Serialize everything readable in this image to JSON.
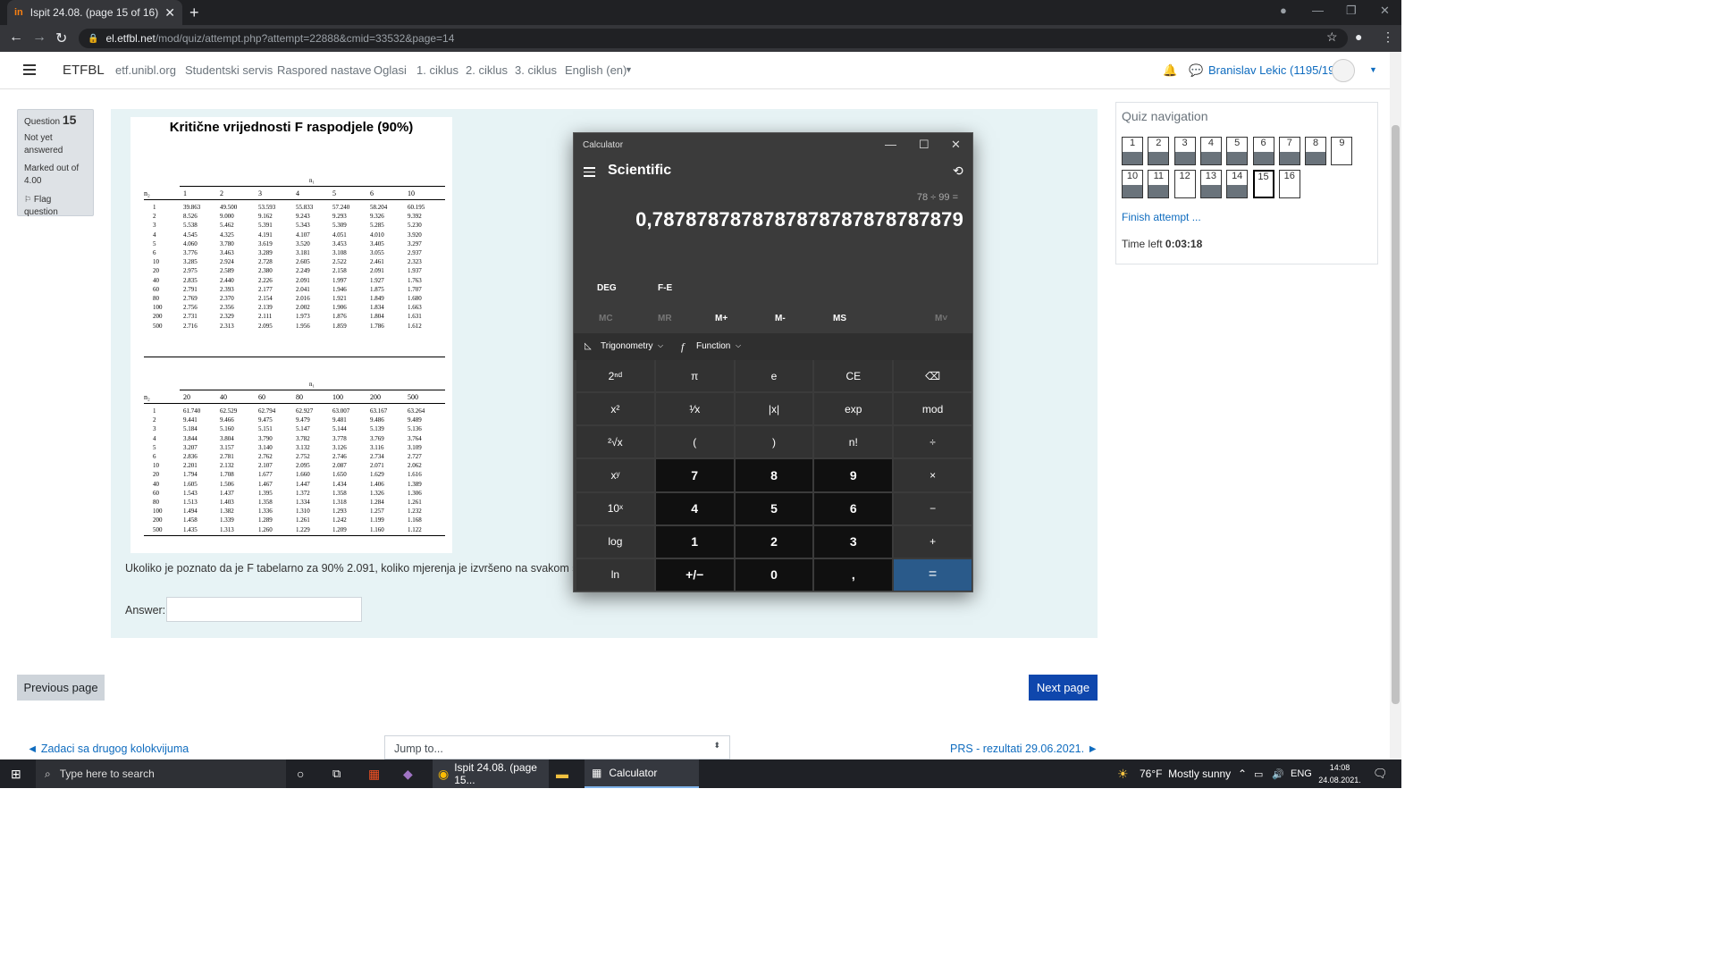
{
  "browser": {
    "tab_title": "Ispit 24.08. (page 15 of 16)",
    "tab_favicon": "in",
    "new_tab": "+",
    "url_host": "el.etfbl.net",
    "url_path": "/mod/quiz/attempt.php?attempt=22888&cmid=33532&page=14"
  },
  "moodle_nav": {
    "brand": "ETFBL",
    "links": [
      "etf.unibl.org",
      "Studentski servis",
      "Raspored nastave",
      "Oglasi",
      "1. ciklus",
      "2. ciklus",
      "3. ciklus",
      "English (en)"
    ],
    "user": "Branislav Lekic (1195/19)"
  },
  "question_info": {
    "label": "Question",
    "number": "15",
    "status": "Not yet answered",
    "marks": "Marked out of 4.00",
    "flag": "Flag question"
  },
  "table_image": {
    "title": "Kritične vrijednosti F raspodjele (90%)",
    "n1_label": "n₁",
    "n2_label": "n₂",
    "top_cols": [
      "1",
      "2",
      "3",
      "4",
      "5",
      "6",
      "10"
    ],
    "bottom_cols": [
      "20",
      "40",
      "60",
      "80",
      "100",
      "200",
      "500"
    ],
    "row_labels": [
      "1",
      "2",
      "3",
      "4",
      "5",
      "6",
      "10",
      "20",
      "40",
      "60",
      "80",
      "100",
      "200",
      "500"
    ],
    "top_rows": [
      [
        "39.863",
        "49.500",
        "53.593",
        "55.833",
        "57.240",
        "58.204",
        "60.195"
      ],
      [
        "8.526",
        "9.000",
        "9.162",
        "9.243",
        "9.293",
        "9.326",
        "9.392"
      ],
      [
        "5.538",
        "5.462",
        "5.391",
        "5.343",
        "5.309",
        "5.285",
        "5.230"
      ],
      [
        "4.545",
        "4.325",
        "4.191",
        "4.107",
        "4.051",
        "4.010",
        "3.920"
      ],
      [
        "4.060",
        "3.780",
        "3.619",
        "3.520",
        "3.453",
        "3.405",
        "3.297"
      ],
      [
        "3.776",
        "3.463",
        "3.289",
        "3.181",
        "3.108",
        "3.055",
        "2.937"
      ],
      [
        "3.285",
        "2.924",
        "2.728",
        "2.605",
        "2.522",
        "2.461",
        "2.323"
      ],
      [
        "2.975",
        "2.589",
        "2.380",
        "2.249",
        "2.158",
        "2.091",
        "1.937"
      ],
      [
        "2.835",
        "2.440",
        "2.226",
        "2.091",
        "1.997",
        "1.927",
        "1.763"
      ],
      [
        "2.791",
        "2.393",
        "2.177",
        "2.041",
        "1.946",
        "1.875",
        "1.707"
      ],
      [
        "2.769",
        "2.370",
        "2.154",
        "2.016",
        "1.921",
        "1.849",
        "1.680"
      ],
      [
        "2.756",
        "2.356",
        "2.139",
        "2.002",
        "1.906",
        "1.834",
        "1.663"
      ],
      [
        "2.731",
        "2.329",
        "2.111",
        "1.973",
        "1.876",
        "1.804",
        "1.631"
      ],
      [
        "2.716",
        "2.313",
        "2.095",
        "1.956",
        "1.859",
        "1.786",
        "1.612"
      ]
    ],
    "bottom_rows": [
      [
        "61.740",
        "62.529",
        "62.794",
        "62.927",
        "63.007",
        "63.167",
        "63.264"
      ],
      [
        "9.441",
        "9.466",
        "9.475",
        "9.479",
        "9.481",
        "9.486",
        "9.489"
      ],
      [
        "5.184",
        "5.160",
        "5.151",
        "5.147",
        "5.144",
        "5.139",
        "5.136"
      ],
      [
        "3.844",
        "3.804",
        "3.790",
        "3.782",
        "3.778",
        "3.769",
        "3.764"
      ],
      [
        "3.207",
        "3.157",
        "3.140",
        "3.132",
        "3.126",
        "3.116",
        "3.109"
      ],
      [
        "2.836",
        "2.781",
        "2.762",
        "2.752",
        "2.746",
        "2.734",
        "2.727"
      ],
      [
        "2.201",
        "2.132",
        "2.107",
        "2.095",
        "2.087",
        "2.071",
        "2.062"
      ],
      [
        "1.794",
        "1.708",
        "1.677",
        "1.660",
        "1.650",
        "1.629",
        "1.616"
      ],
      [
        "1.605",
        "1.506",
        "1.467",
        "1.447",
        "1.434",
        "1.406",
        "1.389"
      ],
      [
        "1.543",
        "1.437",
        "1.395",
        "1.372",
        "1.358",
        "1.326",
        "1.306"
      ],
      [
        "1.513",
        "1.403",
        "1.358",
        "1.334",
        "1.318",
        "1.284",
        "1.261"
      ],
      [
        "1.494",
        "1.382",
        "1.336",
        "1.310",
        "1.293",
        "1.257",
        "1.232"
      ],
      [
        "1.458",
        "1.339",
        "1.289",
        "1.261",
        "1.242",
        "1.199",
        "1.168"
      ],
      [
        "1.435",
        "1.313",
        "1.260",
        "1.229",
        "1.209",
        "1.160",
        "1.122"
      ]
    ]
  },
  "question": {
    "text": "Ukoliko je poznato da je F tabelarno za 90% 2.091, koliko mjerenja je izvršeno na svakom sist",
    "answer_label": "Answer:",
    "answer_value": ""
  },
  "quiz_nav": {
    "title": "Quiz navigation",
    "buttons": [
      "1",
      "2",
      "3",
      "4",
      "5",
      "6",
      "7",
      "8",
      "9",
      "10",
      "11",
      "12",
      "13",
      "14",
      "15",
      "16"
    ],
    "finish": "Finish attempt ...",
    "time_label": "Time left",
    "time_value": "0:03:18"
  },
  "page_buttons": {
    "previous": "Previous page",
    "next": "Next page"
  },
  "footer": {
    "prev_link": "◄ Zadaci sa drugog kolokvijuma",
    "jump": "Jump to...",
    "next_link": "PRS - rezultati 29.06.2021. ►"
  },
  "calculator": {
    "window_title": "Calculator",
    "mode": "Scientific",
    "expression": "78 ÷ 99 =",
    "display": "0,7878787878787878787878787879",
    "deg": "DEG",
    "fe": "F-E",
    "memory": [
      "MC",
      "MR",
      "M+",
      "M-",
      "MS",
      "M˅"
    ],
    "trig": "Trigonometry",
    "func": "Function",
    "keys": [
      "2ⁿᵈ",
      "π",
      "e",
      "CE",
      "⌫",
      "x²",
      "¹⁄x",
      "|x|",
      "exp",
      "mod",
      "²√x",
      "(",
      ")",
      "n!",
      "÷",
      "xʸ",
      "7",
      "8",
      "9",
      "×",
      "10ˣ",
      "4",
      "5",
      "6",
      "−",
      "log",
      "1",
      "2",
      "3",
      "+",
      "ln",
      "+/−",
      "0",
      ",",
      "="
    ]
  },
  "taskbar": {
    "search_placeholder": "Type here to search",
    "chrome_label": "Ispit 24.08. (page 15...",
    "calc_label": "Calculator",
    "weather": "76°F  Mostly sunny",
    "lang": "ENG",
    "time": "14:08",
    "date": "24.08.2021."
  }
}
